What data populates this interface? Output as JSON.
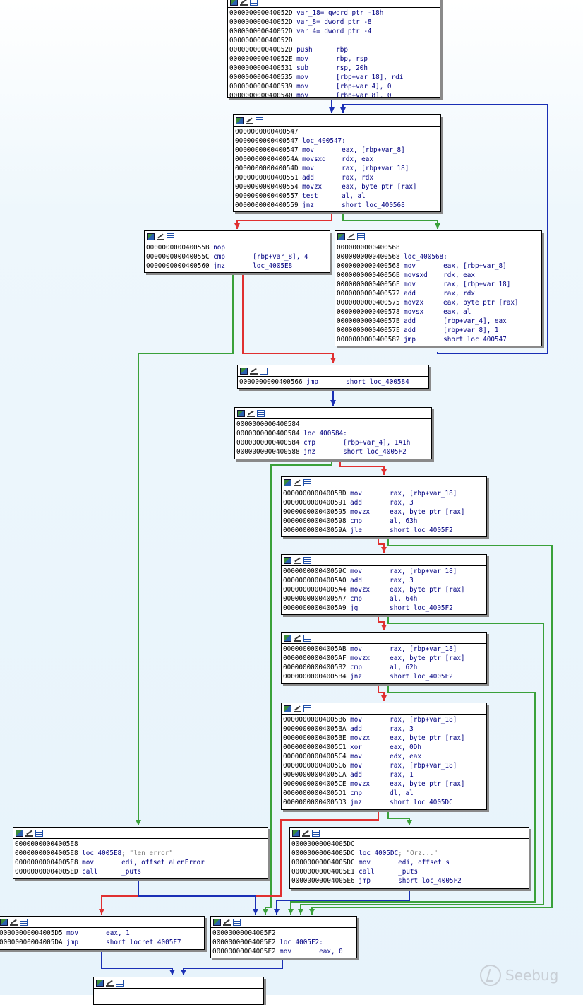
{
  "colors": {
    "true_edge": "#3aa13a",
    "false_edge": "#e03030",
    "uncond_edge": "#1a2fb5"
  },
  "watermark": "Seebug",
  "nodes": {
    "n_entry": {
      "lines": [
        [
          "000000000040052D",
          "var_18= qword ptr -18h",
          "",
          ""
        ],
        [
          "000000000040052D",
          "var_8= dword ptr -8",
          "",
          ""
        ],
        [
          "000000000040052D",
          "var_4= dword ptr -4",
          "",
          ""
        ],
        [
          "000000000040052D",
          "",
          "",
          ""
        ],
        [
          "000000000040052D",
          "push",
          "rbp",
          ""
        ],
        [
          "000000000040052E",
          "mov",
          "rbp, rsp",
          ""
        ],
        [
          "0000000000400531",
          "sub",
          "rsp, 20h",
          ""
        ],
        [
          "0000000000400535",
          "mov",
          "[rbp+var_18], rdi",
          ""
        ],
        [
          "0000000000400539",
          "mov",
          "[rbp+var_4], 0",
          ""
        ],
        [
          "0000000000400540",
          "mov",
          "[rbp+var_8], 0",
          ""
        ]
      ]
    },
    "n_547": {
      "lines": [
        [
          "0000000000400547",
          "",
          "",
          ""
        ],
        [
          "0000000000400547",
          "loc_400547:",
          "",
          ""
        ],
        [
          "0000000000400547",
          "mov",
          "eax, [rbp+var_8]",
          ""
        ],
        [
          "000000000040054A",
          "movsxd",
          "rdx, eax",
          ""
        ],
        [
          "000000000040054D",
          "mov",
          "rax, [rbp+var_18]",
          ""
        ],
        [
          "0000000000400551",
          "add",
          "rax, rdx",
          ""
        ],
        [
          "0000000000400554",
          "movzx",
          "eax, byte ptr [rax]",
          ""
        ],
        [
          "0000000000400557",
          "test",
          "al, al",
          ""
        ],
        [
          "0000000000400559",
          "jnz",
          "short loc_400568",
          ""
        ]
      ]
    },
    "n_55b": {
      "lines": [
        [
          "000000000040055B",
          "nop",
          "",
          ""
        ],
        [
          "000000000040055C",
          "cmp",
          "[rbp+var_8], 4",
          ""
        ],
        [
          "0000000000400560",
          "jnz",
          "loc_4005E8",
          ""
        ]
      ]
    },
    "n_568": {
      "lines": [
        [
          "0000000000400568",
          "",
          "",
          ""
        ],
        [
          "0000000000400568",
          "loc_400568:",
          "",
          ""
        ],
        [
          "0000000000400568",
          "mov",
          "eax, [rbp+var_8]",
          ""
        ],
        [
          "000000000040056B",
          "movsxd",
          "rdx, eax",
          ""
        ],
        [
          "000000000040056E",
          "mov",
          "rax, [rbp+var_18]",
          ""
        ],
        [
          "0000000000400572",
          "add",
          "rax, rdx",
          ""
        ],
        [
          "0000000000400575",
          "movzx",
          "eax, byte ptr [rax]",
          ""
        ],
        [
          "0000000000400578",
          "movsx",
          "eax, al",
          ""
        ],
        [
          "000000000040057B",
          "add",
          "[rbp+var_4], eax",
          ""
        ],
        [
          "000000000040057E",
          "add",
          "[rbp+var_8], 1",
          ""
        ],
        [
          "0000000000400582",
          "jmp",
          "short loc_400547",
          ""
        ]
      ]
    },
    "n_566": {
      "lines": [
        [
          "0000000000400566",
          "jmp",
          "short loc_400584",
          ""
        ]
      ]
    },
    "n_584": {
      "lines": [
        [
          "0000000000400584",
          "",
          "",
          ""
        ],
        [
          "0000000000400584",
          "loc_400584:",
          "",
          ""
        ],
        [
          "0000000000400584",
          "cmp",
          "[rbp+var_4], 1A1h",
          ""
        ],
        [
          "0000000000400588",
          "jnz",
          "short loc_4005F2",
          ""
        ]
      ]
    },
    "n_58d": {
      "lines": [
        [
          "000000000040058D",
          "mov",
          "rax, [rbp+var_18]",
          ""
        ],
        [
          "0000000000400591",
          "add",
          "rax, 3",
          ""
        ],
        [
          "0000000000400595",
          "movzx",
          "eax, byte ptr [rax]",
          ""
        ],
        [
          "0000000000400598",
          "cmp",
          "al, 63h",
          ""
        ],
        [
          "000000000040059A",
          "jle",
          "short loc_4005F2",
          ""
        ]
      ]
    },
    "n_59c": {
      "lines": [
        [
          "000000000040059C",
          "mov",
          "rax, [rbp+var_18]",
          ""
        ],
        [
          "00000000004005A0",
          "add",
          "rax, 3",
          ""
        ],
        [
          "00000000004005A4",
          "movzx",
          "eax, byte ptr [rax]",
          ""
        ],
        [
          "00000000004005A7",
          "cmp",
          "al, 64h",
          ""
        ],
        [
          "00000000004005A9",
          "jg",
          "short loc_4005F2",
          ""
        ]
      ]
    },
    "n_5ab": {
      "lines": [
        [
          "00000000004005AB",
          "mov",
          "rax, [rbp+var_18]",
          ""
        ],
        [
          "00000000004005AF",
          "movzx",
          "eax, byte ptr [rax]",
          ""
        ],
        [
          "00000000004005B2",
          "cmp",
          "al, 62h",
          ""
        ],
        [
          "00000000004005B4",
          "jnz",
          "short loc_4005F2",
          ""
        ]
      ]
    },
    "n_5b6": {
      "lines": [
        [
          "00000000004005B6",
          "mov",
          "rax, [rbp+var_18]",
          ""
        ],
        [
          "00000000004005BA",
          "add",
          "rax, 3",
          ""
        ],
        [
          "00000000004005BE",
          "movzx",
          "eax, byte ptr [rax]",
          ""
        ],
        [
          "00000000004005C1",
          "xor",
          "eax, 0Dh",
          ""
        ],
        [
          "00000000004005C4",
          "mov",
          "edx, eax",
          ""
        ],
        [
          "00000000004005C6",
          "mov",
          "rax, [rbp+var_18]",
          ""
        ],
        [
          "00000000004005CA",
          "add",
          "rax, 1",
          ""
        ],
        [
          "00000000004005CE",
          "movzx",
          "eax, byte ptr [rax]",
          ""
        ],
        [
          "00000000004005D1",
          "cmp",
          "dl, al",
          ""
        ],
        [
          "00000000004005D3",
          "jnz",
          "short loc_4005DC",
          ""
        ]
      ]
    },
    "n_5e8": {
      "lines": [
        [
          "00000000004005E8",
          "",
          "",
          ""
        ],
        [
          "00000000004005E8",
          "loc_4005E8:",
          "",
          "; \"len error\""
        ],
        [
          "00000000004005E8",
          "mov",
          "edi, offset aLenError",
          ""
        ],
        [
          "00000000004005ED",
          "call",
          "_puts",
          ""
        ]
      ]
    },
    "n_5dc": {
      "lines": [
        [
          "00000000004005DC",
          "",
          "",
          ""
        ],
        [
          "00000000004005DC",
          "loc_4005DC:",
          "",
          "; \"Orz...\""
        ],
        [
          "00000000004005DC",
          "mov",
          "edi, offset s",
          ""
        ],
        [
          "00000000004005E1",
          "call",
          "_puts",
          ""
        ],
        [
          "00000000004005E6",
          "jmp",
          "short loc_4005F2",
          ""
        ]
      ]
    },
    "n_5d5": {
      "lines": [
        [
          "00000000004005D5",
          "mov",
          "eax, 1",
          ""
        ],
        [
          "00000000004005DA",
          "jmp",
          "short locret_4005F7",
          ""
        ]
      ]
    },
    "n_5f2": {
      "lines": [
        [
          "00000000004005F2",
          "",
          "",
          ""
        ],
        [
          "00000000004005F2",
          "loc_4005F2:",
          "",
          ""
        ],
        [
          "00000000004005F2",
          "mov",
          "eax, 0",
          ""
        ]
      ]
    },
    "n_bottom": {
      "lines": []
    }
  }
}
